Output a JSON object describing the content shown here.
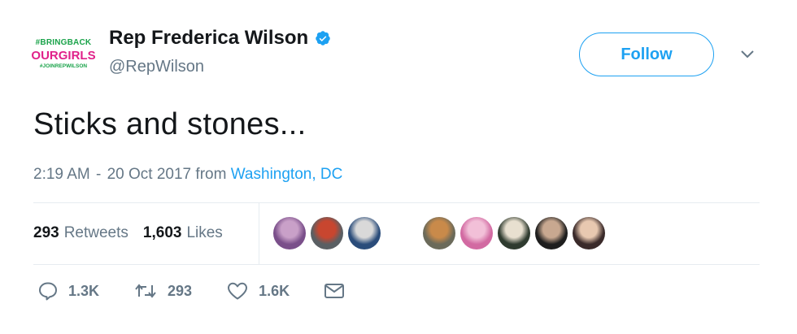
{
  "header": {
    "avatar": {
      "line1": "#BRINGBACK",
      "line2": "OURGIRLS",
      "line3": "#JOINREPWILSON"
    },
    "user_name": "Rep Frederica Wilson",
    "verified_icon": "verified-badge-icon",
    "handle": "@RepWilson",
    "follow_label": "Follow",
    "caret_icon": "chevron-down-icon"
  },
  "tweet": {
    "text": "Sticks and stones...",
    "time": "2:19 AM",
    "separator": "-",
    "date": "20 Oct 2017",
    "from_label": "from",
    "location": "Washington, DC"
  },
  "stats": {
    "retweets_count": "293",
    "retweets_label": "Retweets",
    "likes_count": "1,603",
    "likes_label": "Likes"
  },
  "likers": [
    {
      "colors": [
        "#7a4f8a",
        "#c9a0c8"
      ]
    },
    {
      "colors": [
        "#5a5f63",
        "#c8462f"
      ]
    },
    {
      "colors": [
        "#2a4c7a",
        "#d9d9d9"
      ]
    },
    {
      "colors": [
        "#ffffff",
        "#cfcfcf"
      ]
    },
    {
      "colors": [
        "#6b6a5a",
        "#c98a4a"
      ]
    },
    {
      "colors": [
        "#d26aa2",
        "#f2c0d8"
      ]
    },
    {
      "colors": [
        "#2f3b2f",
        "#e8e0d0"
      ]
    },
    {
      "colors": [
        "#1e1e1e",
        "#c8a890"
      ]
    },
    {
      "colors": [
        "#3a2a2a",
        "#e8c8b0"
      ]
    }
  ],
  "actions": {
    "reply_count": "1.3K",
    "retweet_count": "293",
    "like_count": "1.6K"
  },
  "colors": {
    "accent": "#1da1f2",
    "text": "#14171a",
    "muted": "#657786",
    "border": "#e6ecf0"
  }
}
